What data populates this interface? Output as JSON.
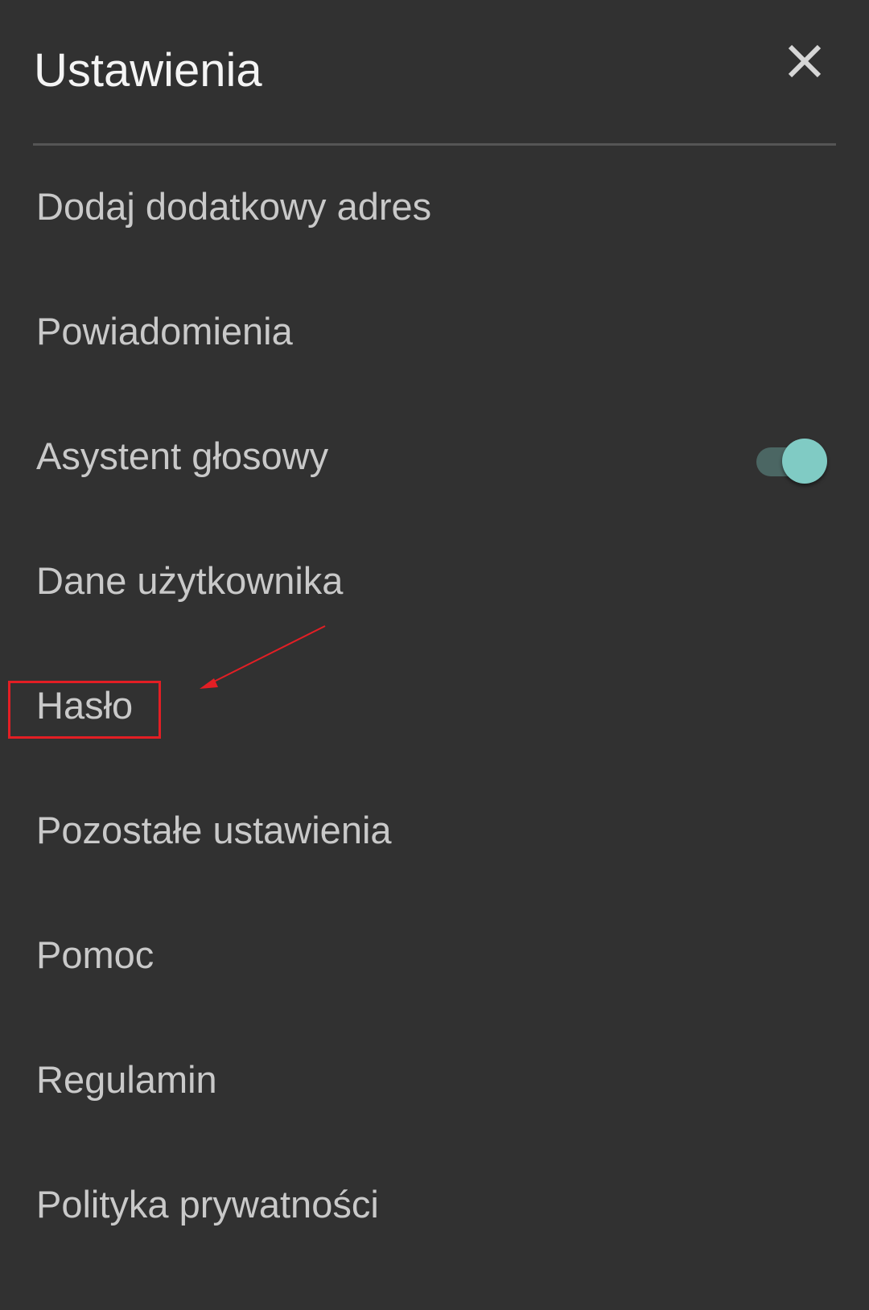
{
  "header": {
    "title": "Ustawienia",
    "close_icon": "close-icon"
  },
  "menu": {
    "items": [
      {
        "label": "Dodaj dodatkowy adres"
      },
      {
        "label": "Powiadomienia"
      },
      {
        "label": "Asystent głosowy",
        "toggle_on": true
      },
      {
        "label": "Dane użytkownika"
      },
      {
        "label": "Hasło",
        "highlighted": true
      },
      {
        "label": "Pozostałe ustawienia"
      },
      {
        "label": "Pomoc"
      },
      {
        "label": "Regulamin"
      },
      {
        "label": "Polityka prywatności"
      }
    ]
  },
  "colors": {
    "background": "#313131",
    "title_text": "#f4f4f4",
    "item_text": "#c9c9c9",
    "divider": "#555555",
    "toggle_knob": "#80cbc4",
    "toggle_track": "#4b6663",
    "annotation": "#e31e24"
  }
}
